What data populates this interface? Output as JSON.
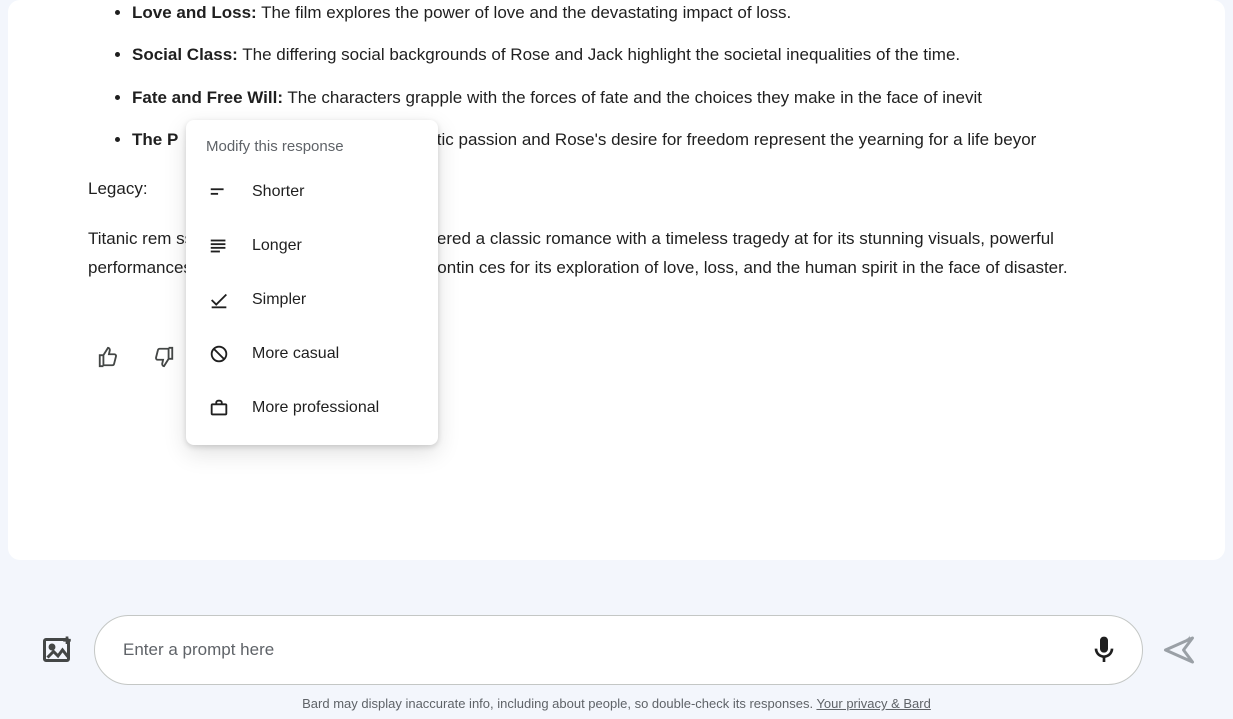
{
  "themes": [
    {
      "label": "Love and Loss:",
      "text": " The film explores the power of love and the devastating impact of loss."
    },
    {
      "label": "Social Class:",
      "text": " The differing social backgrounds of Rose and Jack highlight the societal inequalities of the time."
    },
    {
      "label": "Fate and Free Will:",
      "text": " The characters grapple with the forces of fate and the choices they make in the face of inevit"
    },
    {
      "label": "The P",
      "text": "stic passion and Rose's desire for freedom represent the yearning for a life beyor"
    }
  ],
  "legacy_heading": "Legacy:",
  "legacy_body": "Titanic rem                                                    ssing films of all time and is considered a classic romance with a timeless tragedy at                                                    for its stunning visuals, powerful performances, and emotional score. The film contin                                               ces for its exploration of love, loss, and the human spirit in the face of disaster.",
  "popup": {
    "title": "Modify this response",
    "items": {
      "shorter": "Shorter",
      "longer": "Longer",
      "simpler": "Simpler",
      "casual": "More casual",
      "professional": "More professional"
    }
  },
  "prompt": {
    "placeholder": "Enter a prompt here"
  },
  "disclaimer": {
    "text": "Bard may display inaccurate info, including about people, so double-check its responses. ",
    "link": "Your privacy & Bard"
  }
}
